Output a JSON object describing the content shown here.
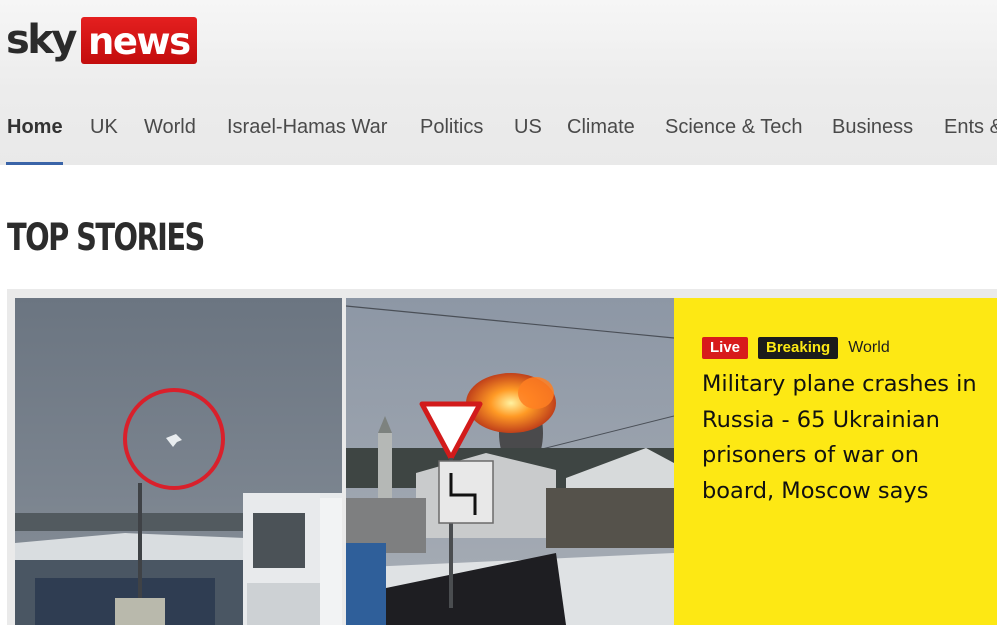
{
  "logo": {
    "sky": "sky",
    "news": "news",
    "brand_color": "#d30f0f"
  },
  "nav": {
    "items": [
      {
        "label": "Home",
        "active": true
      },
      {
        "label": "UK"
      },
      {
        "label": "World"
      },
      {
        "label": "Israel-Hamas War"
      },
      {
        "label": "Politics"
      },
      {
        "label": "US"
      },
      {
        "label": "Climate"
      },
      {
        "label": "Science & Tech"
      },
      {
        "label": "Business"
      },
      {
        "label": "Ents &"
      }
    ],
    "accent_color": "#3a64a8"
  },
  "section": {
    "title": "TOP STORIES"
  },
  "top_story": {
    "images": [
      {
        "icon": "plane-circled-photo"
      },
      {
        "icon": "explosion-photo"
      }
    ],
    "badges": {
      "live": "Live",
      "breaking": "Breaking"
    },
    "category": "World",
    "headline": "Military plane crashes in Russia - 65 Ukrainian prisoners of war on board, Moscow says",
    "background_color": "#fde814"
  }
}
